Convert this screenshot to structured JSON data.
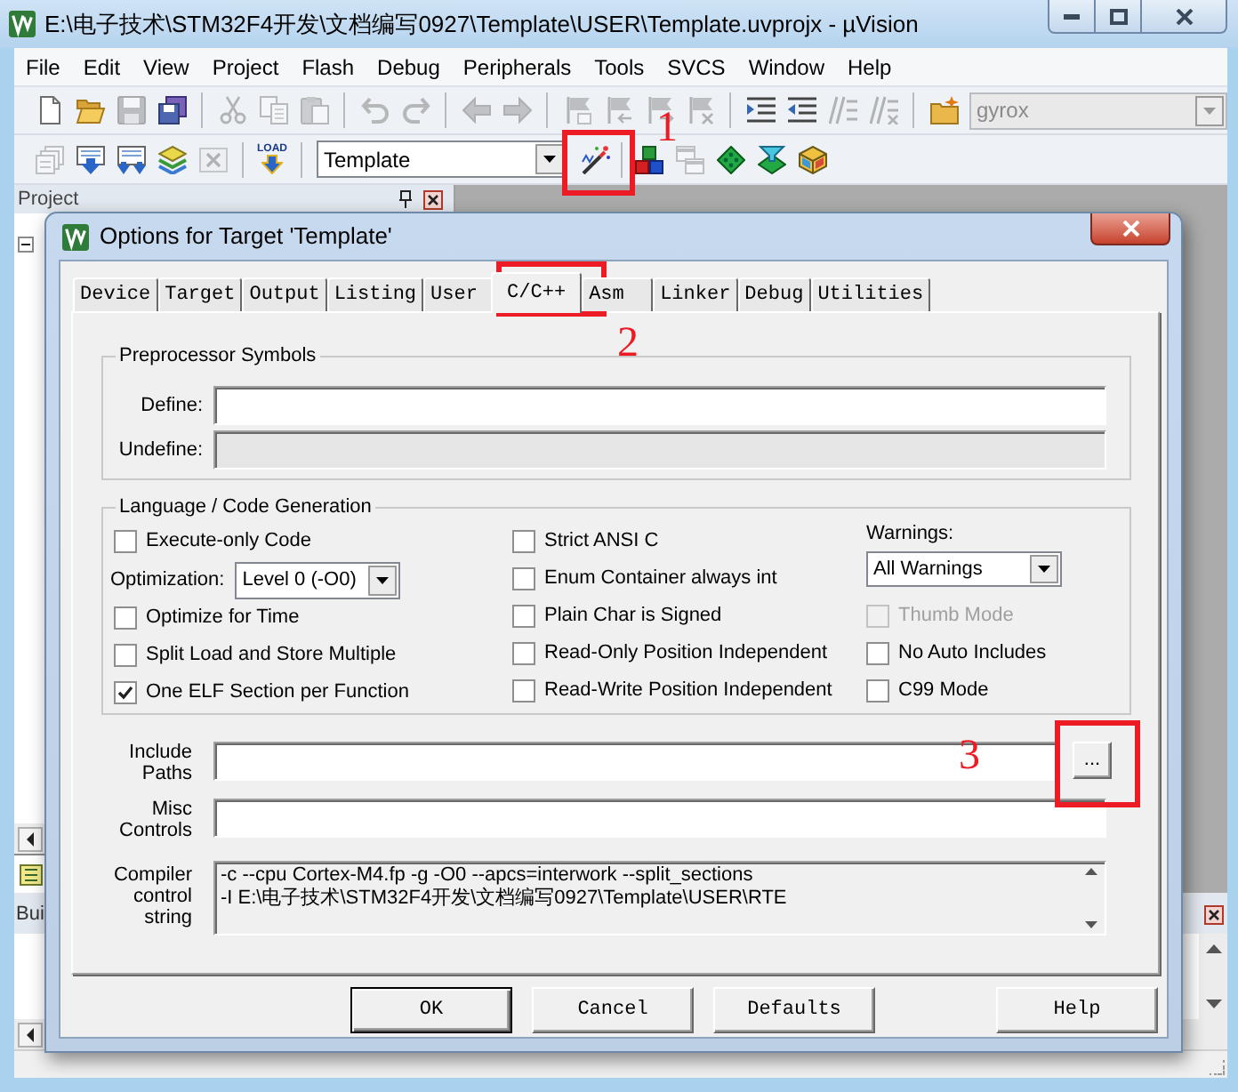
{
  "window": {
    "title": "E:\\电子技术\\STM32F4开发\\文档编写0927\\Template\\USER\\Template.uvprojx - µVision"
  },
  "menu": [
    "File",
    "Edit",
    "View",
    "Project",
    "Flash",
    "Debug",
    "Peripherals",
    "Tools",
    "SVCS",
    "Window",
    "Help"
  ],
  "toolbar_1": {
    "groups": [
      {
        "buttons": [
          {
            "disabled": false
          },
          {
            "disabled": false
          },
          {
            "disabled": true
          },
          {
            "disabled": false
          }
        ]
      },
      {
        "buttons": [
          {
            "disabled": true
          },
          {
            "disabled": true
          },
          {
            "disabled": true
          }
        ]
      },
      {
        "buttons": [
          {
            "disabled": true
          },
          {
            "disabled": true
          }
        ]
      },
      {
        "buttons": [
          {
            "disabled": true
          },
          {
            "disabled": true
          }
        ]
      },
      {
        "buttons": [
          {
            "disabled": true
          },
          {
            "disabled": true
          },
          {
            "disabled": true
          },
          {
            "disabled": true
          }
        ]
      },
      {
        "buttons": [
          {
            "disabled": false
          },
          {
            "disabled": false
          },
          {
            "disabled": true
          },
          {
            "disabled": true
          }
        ]
      },
      {
        "buttons": [
          {
            "disabled": false
          }
        ]
      }
    ],
    "combo": {
      "value": "gyrox",
      "disabled": true
    }
  },
  "toolbar_2": {
    "build_buttons": [
      {
        "disabled": true
      },
      {
        "disabled": false
      },
      {
        "disabled": false
      },
      {
        "disabled": false
      },
      {
        "disabled": true
      }
    ],
    "load_button": {
      "label": "LOAD"
    },
    "target": {
      "value": "Template"
    },
    "option_buttons": [
      {
        "disabled": false
      },
      {
        "disabled": false
      },
      {
        "disabled": true
      },
      {
        "disabled": false
      },
      {
        "disabled": false
      },
      {
        "disabled": false
      }
    ]
  },
  "project_panel": {
    "title": "Project",
    "tree_root": {
      "expanded": true
    }
  },
  "build_output": {
    "title": "Bui"
  },
  "dialog": {
    "title": "Options for Target 'Template'",
    "tabs": [
      {
        "label": "Device",
        "selected": false
      },
      {
        "label": "Target",
        "selected": false
      },
      {
        "label": "Output",
        "selected": false
      },
      {
        "label": "Listing",
        "selected": false
      },
      {
        "label": "User",
        "selected": false
      },
      {
        "label": "C/C++",
        "selected": true
      },
      {
        "label": "Asm",
        "selected": false
      },
      {
        "label": "Linker",
        "selected": false
      },
      {
        "label": "Debug",
        "selected": false
      },
      {
        "label": "Utilities",
        "selected": false
      }
    ],
    "preprocessor": {
      "title": "Preprocessor Symbols",
      "fields": [
        {
          "label": "Define:",
          "disabled": false
        },
        {
          "label": "Undefine:",
          "disabled": true
        }
      ]
    },
    "language": {
      "title": "Language / Code Generation",
      "columns": [
        [
          {
            "kind": "checkbox",
            "label": "Execute-only Code",
            "checked": false,
            "disabled": false
          },
          {
            "kind": "select",
            "label": "Optimization:",
            "value": "Level 0 (-O0)"
          },
          {
            "kind": "checkbox",
            "label": "Optimize for Time",
            "checked": false,
            "disabled": false
          },
          {
            "kind": "checkbox",
            "label": "Split Load and Store Multiple",
            "checked": false,
            "disabled": false
          },
          {
            "kind": "checkbox",
            "label": "One ELF Section per Function",
            "checked": true,
            "disabled": false
          }
        ],
        [
          {
            "kind": "checkbox",
            "label": "Strict ANSI C",
            "checked": false,
            "disabled": false
          },
          {
            "kind": "checkbox",
            "label": "Enum Container always int",
            "checked": false,
            "disabled": false
          },
          {
            "kind": "checkbox",
            "label": "Plain Char is Signed",
            "checked": false,
            "disabled": false
          },
          {
            "kind": "checkbox",
            "label": "Read-Only Position Independent",
            "checked": false,
            "disabled": false
          },
          {
            "kind": "checkbox",
            "label": "Read-Write Position Independent",
            "checked": false,
            "disabled": false
          }
        ],
        [
          {
            "kind": "stacked_select",
            "label": "Warnings:",
            "value": "All Warnings"
          },
          {
            "kind": "checkbox",
            "label": "Thumb Mode",
            "checked": false,
            "disabled": true
          },
          {
            "kind": "checkbox",
            "label": "No Auto Includes",
            "checked": false,
            "disabled": false
          },
          {
            "kind": "checkbox",
            "label": "C99 Mode",
            "checked": false,
            "disabled": false
          }
        ]
      ]
    },
    "include": {
      "label": "Include Paths",
      "browse": "..."
    },
    "misc": {
      "label": "Misc Controls"
    },
    "compiler": {
      "label": "Compiler control string",
      "read_only": true,
      "lines": [
        "-c --cpu Cortex-M4.fp -g -O0 --apcs=interwork --split_sections",
        "-I E:\\电子技术\\STM32F4开发\\文档编写0927\\Template\\USER\\RTE"
      ]
    },
    "buttons": [
      {
        "label": "OK",
        "default": true
      },
      {
        "label": "Cancel",
        "default": false
      },
      {
        "label": "Defaults",
        "default": false
      },
      {
        "label": "Help",
        "default": false
      }
    ]
  },
  "annotations": [
    {
      "label": "1"
    },
    {
      "label": "2"
    },
    {
      "label": "3"
    }
  ]
}
